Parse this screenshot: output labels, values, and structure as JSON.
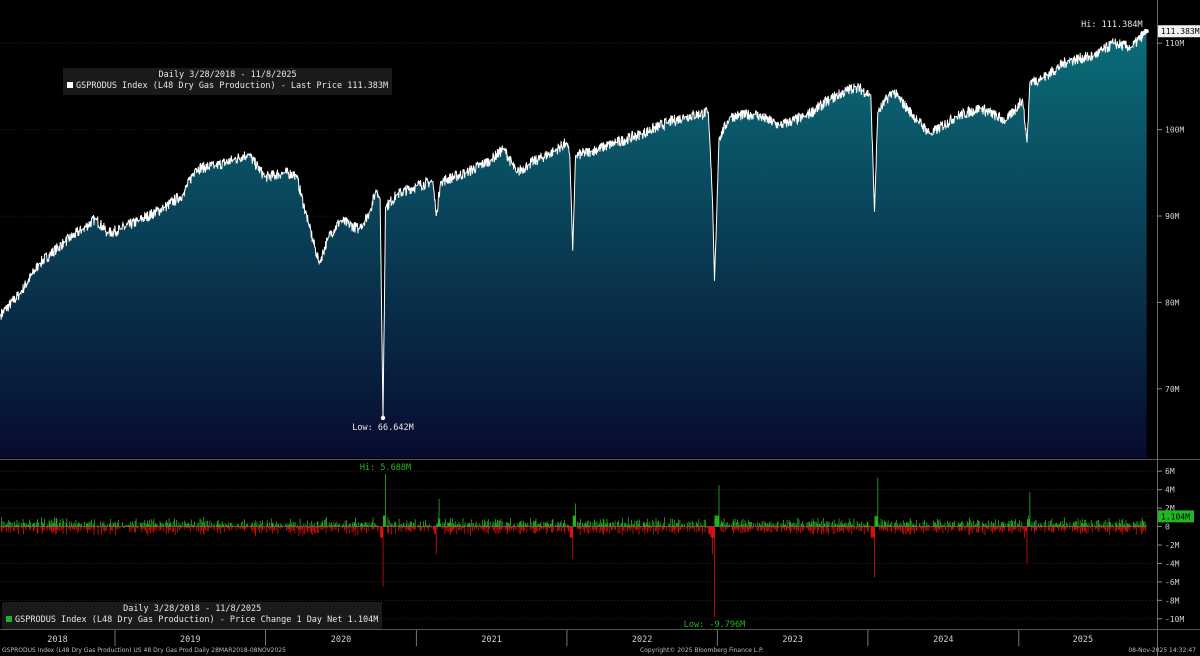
{
  "main_legend": {
    "period": "Daily 3/28/2018 - 11/8/2025",
    "series_label": "GSPRODUS Index (L48 Dry Gas Production) - Last Price 111.383M",
    "swatch_color": "#ffffff"
  },
  "sub_legend": {
    "period": "Daily 3/28/2018 - 11/8/2025",
    "series_label": "GSPRODUS Index (L48 Dry Gas Production) - Price Change 1 Day Net 1.104M",
    "swatch_color": "#22b522"
  },
  "footer": {
    "left": "GSPRODUS Index (L48 Dry Gas Production) US 48 Dry Gas Prod Daily 28MAR2018-08NOV2025",
    "center": "Copyright© 2025 Bloomberg Finance L.P.",
    "right": "08-Nov-2025 14:32:47"
  },
  "colors": {
    "background": "#000000",
    "area_top": "#0a6e7a",
    "area_bottom": "#080b2e",
    "price_line": "#ffffff",
    "gain_bar": "#22b522",
    "loss_bar": "#e01010",
    "grid": "#3a3a3a"
  },
  "chart_data": [
    {
      "type": "area",
      "series": [
        {
          "name": "GSPRODUS Index (L48 Dry Gas Production) - Last Price",
          "unit": "M"
        }
      ],
      "x_range": [
        "2018-03-28",
        "2025-11-08"
      ],
      "ylim": [
        62,
        115
      ],
      "y_ticks": [
        70,
        80,
        90,
        100,
        110
      ],
      "y_tick_labels": [
        "70M",
        "80M",
        "90M",
        "100M",
        "110M"
      ],
      "last_value_label": "111.383M",
      "high": {
        "label": "Hi: 111.384M",
        "date": "2025-11-07",
        "value": 111.384
      },
      "low": {
        "label": "Low: 66.642M",
        "date": "2020-10-12",
        "value": 66.642
      },
      "points": [
        [
          "2018-03-28",
          78.5
        ],
        [
          "2018-05-15",
          81.0
        ],
        [
          "2018-07-01",
          84.5
        ],
        [
          "2018-09-01",
          87.0
        ],
        [
          "2018-10-15",
          88.5
        ],
        [
          "2018-11-15",
          89.7
        ],
        [
          "2018-12-15",
          88.0
        ],
        [
          "2019-01-15",
          88.5
        ],
        [
          "2019-03-01",
          89.5
        ],
        [
          "2019-05-01",
          91.0
        ],
        [
          "2019-06-15",
          92.5
        ],
        [
          "2019-07-15",
          95.5
        ],
        [
          "2019-09-01",
          95.8
        ],
        [
          "2019-10-15",
          96.5
        ],
        [
          "2019-11-20",
          97.2
        ],
        [
          "2019-12-31",
          94.5
        ],
        [
          "2020-02-15",
          95.0
        ],
        [
          "2020-03-15",
          94.8
        ],
        [
          "2020-04-15",
          89.0
        ],
        [
          "2020-05-10",
          84.5
        ],
        [
          "2020-06-01",
          87.5
        ],
        [
          "2020-07-01",
          89.5
        ],
        [
          "2020-08-15",
          88.5
        ],
        [
          "2020-09-10",
          90.5
        ],
        [
          "2020-09-25",
          93.0
        ],
        [
          "2020-10-05",
          92.0
        ],
        [
          "2020-10-12",
          66.642
        ],
        [
          "2020-10-18",
          91.0
        ],
        [
          "2020-11-15",
          92.5
        ],
        [
          "2021-01-01",
          93.5
        ],
        [
          "2021-02-10",
          94.0
        ],
        [
          "2021-02-18",
          90.0
        ],
        [
          "2021-03-01",
          94.0
        ],
        [
          "2021-05-01",
          95.0
        ],
        [
          "2021-07-01",
          96.5
        ],
        [
          "2021-08-01",
          97.8
        ],
        [
          "2021-09-01",
          95.0
        ],
        [
          "2021-10-01",
          96.0
        ],
        [
          "2021-12-01",
          97.5
        ],
        [
          "2021-12-31",
          98.5
        ],
        [
          "2022-01-08",
          97.0
        ],
        [
          "2022-01-15",
          86.0
        ],
        [
          "2022-01-22",
          97.0
        ],
        [
          "2022-03-01",
          97.5
        ],
        [
          "2022-05-01",
          98.5
        ],
        [
          "2022-07-01",
          99.5
        ],
        [
          "2022-09-01",
          100.8
        ],
        [
          "2022-10-15",
          101.5
        ],
        [
          "2022-12-10",
          102.0
        ],
        [
          "2022-12-20",
          92.0
        ],
        [
          "2022-12-25",
          82.5
        ],
        [
          "2023-01-05",
          99.0
        ],
        [
          "2023-02-01",
          101.5
        ],
        [
          "2023-04-01",
          101.8
        ],
        [
          "2023-06-01",
          100.5
        ],
        [
          "2023-08-01",
          101.5
        ],
        [
          "2023-10-01",
          103.5
        ],
        [
          "2023-12-01",
          105.0
        ],
        [
          "2024-01-08",
          104.0
        ],
        [
          "2024-01-17",
          90.5
        ],
        [
          "2024-01-25",
          102.0
        ],
        [
          "2024-03-01",
          104.5
        ],
        [
          "2024-05-01",
          101.0
        ],
        [
          "2024-06-01",
          99.5
        ],
        [
          "2024-08-01",
          101.5
        ],
        [
          "2024-10-01",
          102.5
        ],
        [
          "2024-12-01",
          101.0
        ],
        [
          "2025-01-10",
          103.5
        ],
        [
          "2025-01-21",
          98.5
        ],
        [
          "2025-01-28",
          105.5
        ],
        [
          "2025-03-01",
          106.0
        ],
        [
          "2025-05-01",
          108.0
        ],
        [
          "2025-07-01",
          108.5
        ],
        [
          "2025-08-20",
          110.0
        ],
        [
          "2025-10-01",
          109.5
        ],
        [
          "2025-11-07",
          111.384
        ]
      ]
    },
    {
      "type": "bar",
      "series": [
        {
          "name": "GSPRODUS Index (L48 Dry Gas Production) - Price Change 1 Day Net",
          "unit": "M"
        }
      ],
      "x_range": [
        "2018-03-28",
        "2025-11-08"
      ],
      "ylim": [
        -11,
        7
      ],
      "y_ticks": [
        -10,
        -8,
        -6,
        -4,
        -2,
        0,
        2,
        4,
        6
      ],
      "y_tick_labels": [
        "-10M",
        "-8M",
        "-6M",
        "-4M",
        "-2M",
        "0",
        "2M",
        "4M",
        "6M"
      ],
      "last_value_label": "1.104M",
      "high": {
        "label": "Hi: 5.688M",
        "date": "2020-10-18",
        "value": 5.688
      },
      "low": {
        "label": "Low: -9.796M",
        "date": "2022-12-25",
        "value": -9.796
      },
      "notable_values": [
        [
          "2020-10-12",
          -6.5
        ],
        [
          "2020-10-18",
          5.688
        ],
        [
          "2021-02-18",
          -3.0
        ],
        [
          "2021-02-25",
          3.0
        ],
        [
          "2022-01-15",
          -3.5
        ],
        [
          "2022-01-22",
          2.5
        ],
        [
          "2022-12-20",
          -3.0
        ],
        [
          "2022-12-25",
          -9.796
        ],
        [
          "2023-01-05",
          4.5
        ],
        [
          "2024-01-17",
          -5.5
        ],
        [
          "2024-01-25",
          5.3
        ],
        [
          "2025-01-21",
          -4.0
        ],
        [
          "2025-01-28",
          3.7
        ]
      ],
      "typical_range": [
        -1.2,
        1.2
      ]
    }
  ],
  "x_axis": {
    "year_labels": [
      "2018",
      "2019",
      "2020",
      "2021",
      "2022",
      "2023",
      "2024",
      "2025"
    ]
  }
}
